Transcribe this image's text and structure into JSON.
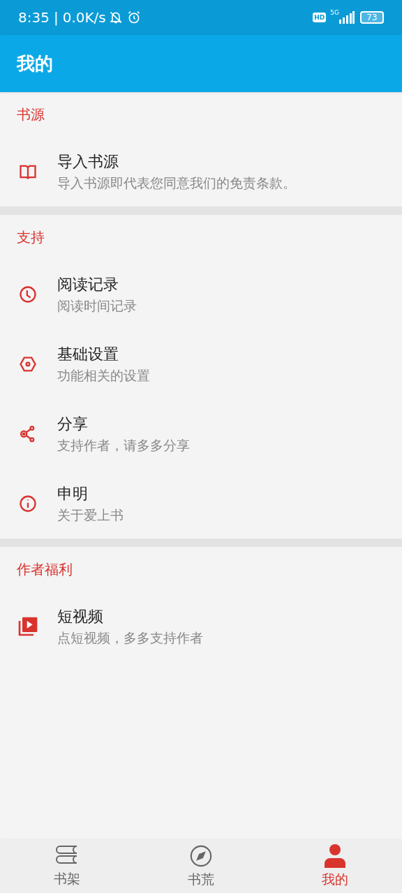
{
  "status_bar": {
    "time": "8:35",
    "separator": "|",
    "speed": "0.0K/s",
    "hd": "HD",
    "network": "5G",
    "battery": "73"
  },
  "app_bar": {
    "title": "我的"
  },
  "sections": [
    {
      "title": "书源",
      "items": [
        {
          "title": "导入书源",
          "subtitle": "导入书源即代表您同意我们的免责条款。"
        }
      ]
    },
    {
      "title": "支持",
      "items": [
        {
          "title": "阅读记录",
          "subtitle": "阅读时间记录"
        },
        {
          "title": "基础设置",
          "subtitle": "功能相关的设置"
        },
        {
          "title": "分享",
          "subtitle": "支持作者，请多多分享"
        },
        {
          "title": "申明",
          "subtitle": "关于爱上书"
        }
      ]
    },
    {
      "title": "作者福利",
      "items": [
        {
          "title": "短视频",
          "subtitle": "点短视频，多多支持作者"
        }
      ]
    }
  ],
  "bottom_nav": [
    {
      "label": "书架",
      "selected": false
    },
    {
      "label": "书荒",
      "selected": false
    },
    {
      "label": "我的",
      "selected": true
    }
  ]
}
